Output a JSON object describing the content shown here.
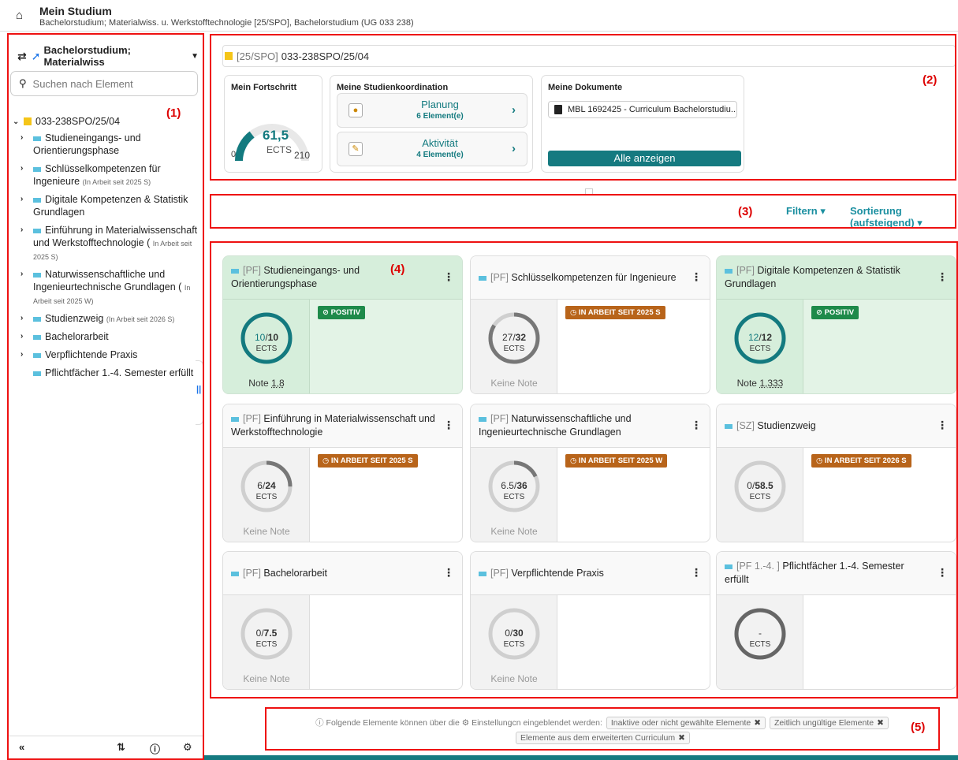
{
  "header": {
    "title": "Mein Studium",
    "subtitle": "Bachelorstudium; Materialwiss. u. Werkstofftechnologie [25/SPO], Bachelorstudium (UG 033 238)"
  },
  "markers": {
    "m1": "(1)",
    "m2": "(2)",
    "m3": "(3)",
    "m4": "(4)",
    "m5": "(5)"
  },
  "sidebar": {
    "switch_label": "Bachelorstudium; Materialwiss",
    "search_placeholder": "Suchen nach Element",
    "root": "033-238SPO/25/04",
    "items": [
      {
        "label": "Studieneingangs- und Orientierungsphase",
        "note": ""
      },
      {
        "label": "Schlüsselkompetenzen für Ingenieure",
        "note": "(In Arbeit seit 2025 S)"
      },
      {
        "label": "Digitale Kompetenzen & Statistik Grundlagen",
        "note": ""
      },
      {
        "label": "Einführung in Materialwissenschaft und Werkstofftechnologie (",
        "note": "In Arbeit seit 2025 S)"
      },
      {
        "label": "Naturwissenschaftliche und Ingenieurtechnische Grundlagen (",
        "note": "In Arbeit seit 2025 W)"
      },
      {
        "label": "Studienzweig",
        "note": "(In Arbeit seit 2026 S)"
      },
      {
        "label": "Bachelorarbeit",
        "note": ""
      },
      {
        "label": "Verpflichtende Praxis",
        "note": ""
      },
      {
        "label": "Pflichtfächer 1.-4. Semester erfüllt",
        "note": ""
      }
    ]
  },
  "overview": {
    "tag": "[25/SPO]",
    "code": "033-238SPO/25/04",
    "progress": {
      "title": "Mein Fortschritt",
      "value": "61,5",
      "unit": "ECTS",
      "min": "0",
      "max": "210",
      "fraction": 0.293
    },
    "coordination": {
      "title": "Meine Studienkoordination",
      "buttons": [
        {
          "label": "Planung",
          "count": "6 Element(e)"
        },
        {
          "label": "Aktivität",
          "count": "4 Element(e)"
        }
      ]
    },
    "documents": {
      "title": "Meine Dokumente",
      "item": "MBL 1692425 - Curriculum Bachelorstudiu...",
      "show_all": "Alle anzeigen"
    }
  },
  "toolbar": {
    "filter": "Filtern ▾",
    "sort": "Sortierung (aufsteigend) ▾"
  },
  "tiles": [
    {
      "prefix": "[PF]",
      "title": "Studieneingangs- und Orientierungsphase",
      "cur": "10",
      "total": "10",
      "unit": "ECTS",
      "note_label": "Note",
      "note_value": "1,8",
      "badge": "⊘ POSITIV",
      "fraction": 1.0
    },
    {
      "prefix": "[PF]",
      "title": "Schlüsselkompetenzen für Ingenieure",
      "cur": "27",
      "total": "32",
      "unit": "ECTS",
      "note_label": "Keine Note",
      "note_value": "",
      "badge": "◷ IN ARBEIT SEIT 2025 S",
      "fraction": 0.84
    },
    {
      "prefix": "[PF]",
      "title": "Digitale Kompetenzen & Statistik Grundlagen",
      "cur": "12",
      "total": "12",
      "unit": "ECTS",
      "note_label": "Note",
      "note_value": "1,333",
      "badge": "⊘ POSITIV",
      "fraction": 1.0
    },
    {
      "prefix": "[PF]",
      "title": "Einführung in Materialwissenschaft und Werkstofftechnologie",
      "cur": "6",
      "total": "24",
      "unit": "ECTS",
      "note_label": "Keine Note",
      "note_value": "",
      "badge": "◷ IN ARBEIT SEIT 2025 S",
      "fraction": 0.25
    },
    {
      "prefix": "[PF]",
      "title": "Naturwissenschaftliche und Ingenieurtechnische Grundlagen",
      "cur": "6.5",
      "total": "36",
      "unit": "ECTS",
      "note_label": "Keine Note",
      "note_value": "",
      "badge": "◷ IN ARBEIT SEIT 2025 W",
      "fraction": 0.18
    },
    {
      "prefix": "[SZ]",
      "title": "Studienzweig",
      "cur": "0",
      "total": "58.5",
      "unit": "ECTS",
      "note_label": "",
      "note_value": "",
      "badge": "◷ IN ARBEIT SEIT 2026 S",
      "fraction": 0.0
    },
    {
      "prefix": "[PF]",
      "title": "Bachelorarbeit",
      "cur": "0",
      "total": "7.5",
      "unit": "ECTS",
      "note_label": "Keine Note",
      "note_value": "",
      "badge": "",
      "fraction": 0.0
    },
    {
      "prefix": "[PF]",
      "title": "Verpflichtende Praxis",
      "cur": "0",
      "total": "30",
      "unit": "ECTS",
      "note_label": "Keine Note",
      "note_value": "",
      "badge": "",
      "fraction": 0.0
    },
    {
      "prefix": "[PF 1.-4. ]",
      "title": "Pflichtfächer 1.-4. Semester erfüllt",
      "cur": "-",
      "total": "",
      "unit": "ECTS",
      "note_label": "",
      "note_value": "",
      "badge": "",
      "fraction": 1.0
    }
  ],
  "footer_info": {
    "text_a": "Folgende Elemente können über die",
    "text_b": "Einstellungcn eingeblendet werden:",
    "chips": [
      "Inaktive oder nicht gewählte Elemente",
      "Zeitlich ungültige Elemente",
      "Elemente aus dem erweiterten Curriculum"
    ]
  },
  "colors": {
    "teal": "#157a80",
    "positive": "#1e8a4a",
    "in_progress": "#b8641a",
    "red_marker": "#e11111"
  }
}
